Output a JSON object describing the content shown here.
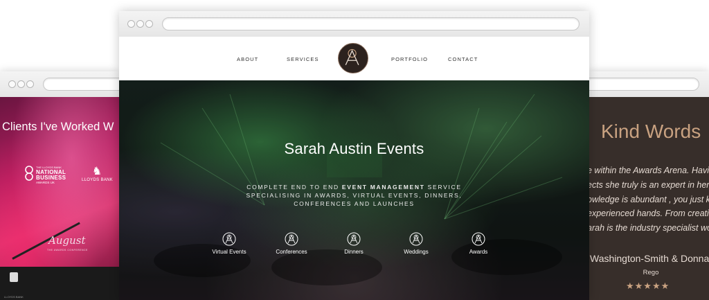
{
  "left_window": {
    "title": "Clients I've Worked W",
    "logos": {
      "nba_small": "THE LLOYDS BANK",
      "nba_line1": "NATIONAL",
      "nba_line2": "BUSINESS",
      "nba_tail": "AWARDS UK",
      "lloyds": "LLOYDS BANK",
      "august": "August",
      "august_sub": "THE AWARDS CONFERENCE"
    },
    "podium_text": "LLOYDS BANK"
  },
  "center_window": {
    "nav": {
      "about": "ABOUT",
      "services": "SERVICES",
      "portfolio": "PORTFOLIO",
      "contact": "CONTACT"
    },
    "logo_letter": "A",
    "hero": {
      "title": "Sarah Austin Events",
      "subtitle_part1": "COMPLETE END TO END ",
      "subtitle_bold": "EVENT MANAGEMENT",
      "subtitle_part2": " SERVICE SPECIALISING IN AWARDS, VIRTUAL EVENTS, DINNERS, CONFERENCES AND LAUNCHES"
    },
    "services": [
      {
        "label": "Virtual Events"
      },
      {
        "label": "Conferences"
      },
      {
        "label": "Dinners"
      },
      {
        "label": "Weddings"
      },
      {
        "label": "Awards"
      }
    ]
  },
  "right_window": {
    "title": "Kind Words",
    "quote_lines": [
      "e within the Awards Arena. Havin",
      "ects she truly is an expert in her f",
      "owledge is abundant , you just k",
      "experienced hands. From creatio",
      "arah is the industry specialist wo"
    ],
    "author": "Washington-Smith & Donna",
    "company": "Rego",
    "rating": 5,
    "stars": "★★★★★"
  }
}
